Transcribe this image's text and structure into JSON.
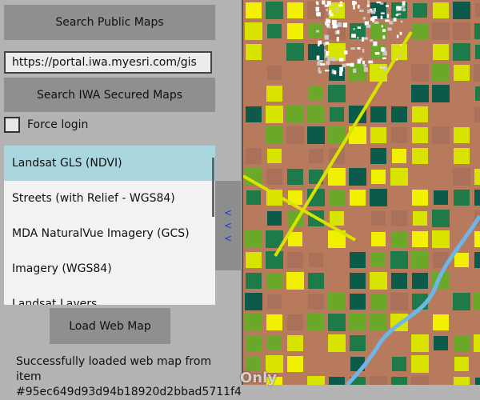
{
  "buttons": {
    "search_public": "Search Public Maps",
    "search_secured": "Search IWA Secured Maps",
    "load_web_map": "Load Web Map"
  },
  "portal_url": "https://portal.iwa.myesri.com/gis",
  "force_login_label": "Force login",
  "map_list": [
    "Landsat GLS (NDVI)",
    "Streets (with Relief - WGS84)",
    "MDA NaturalVue Imagery (GCS)",
    "Imagery (WGS84)",
    "Landsat Layers"
  ],
  "selected_index": 0,
  "splitter_arrows": [
    "<",
    "<",
    "<"
  ],
  "status": {
    "line1": "Successfully loaded web map from item",
    "line2": "#95ec649d93d94b18920d2bbad5711f4"
  },
  "map_watermark": "Only",
  "colors": {
    "selected_bg": "#aad6e0",
    "button_bg": "#8f8f8f",
    "panel_bg": "#b3b3b3",
    "arrow": "#1a3ae0",
    "soil": "#b87a5c",
    "vegetation_dark": "#0c5a4a",
    "vegetation_light": "#d8e400",
    "river": "#6fb6e8"
  }
}
